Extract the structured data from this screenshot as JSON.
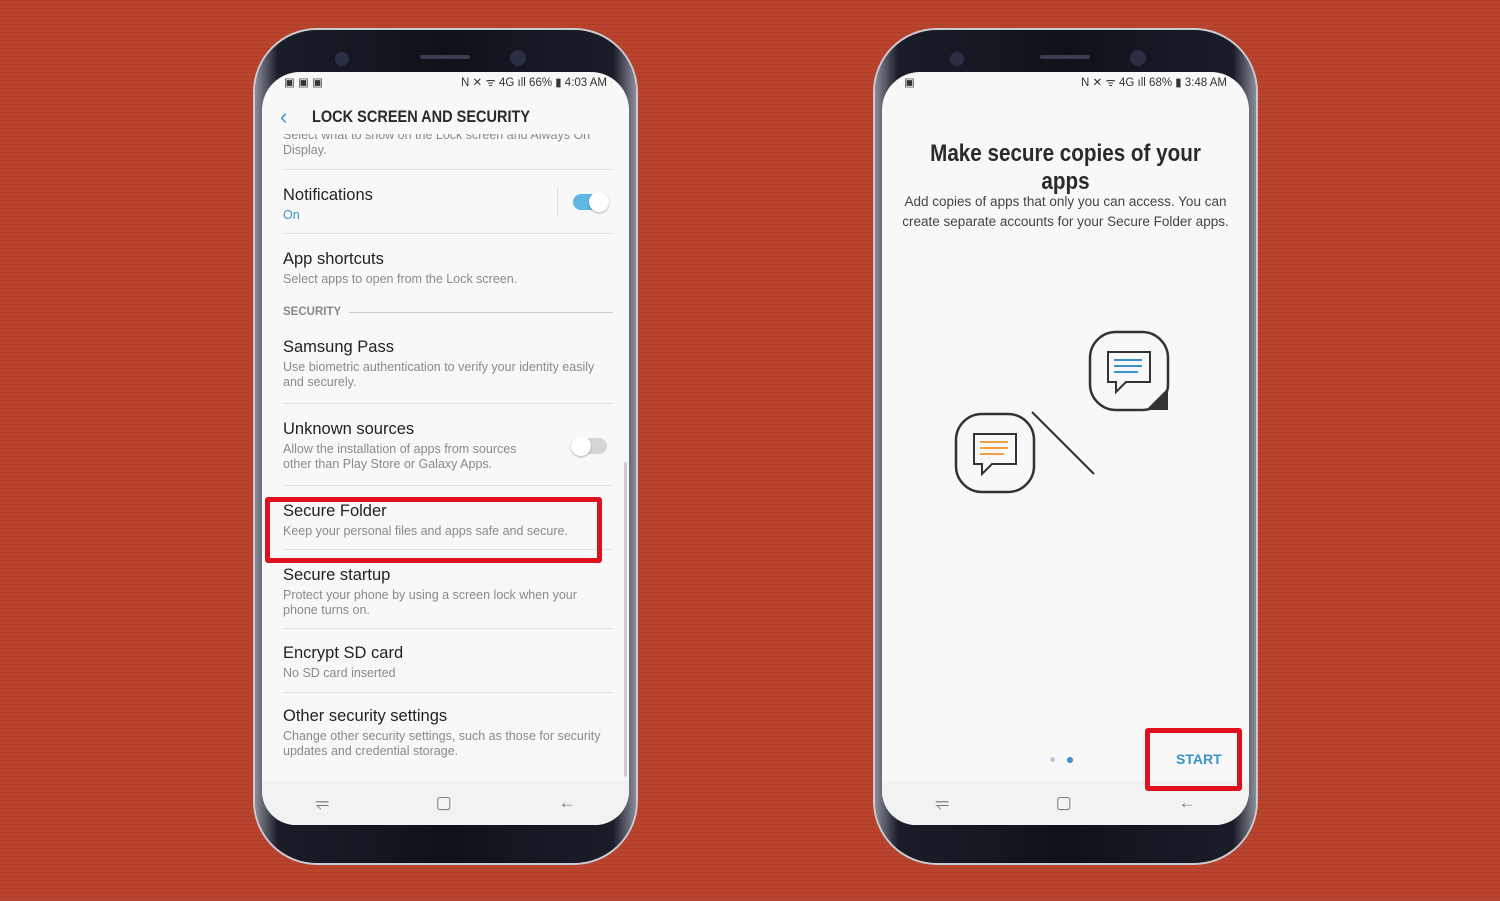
{
  "left_phone": {
    "status": {
      "time": "4:03 AM",
      "battery": "66%"
    },
    "header": {
      "title": "LOCK SCREEN AND SECURITY"
    },
    "partial_item": {
      "subtitle": "Select what to show on the Lock screen and Always On Display."
    },
    "items": [
      {
        "title": "Notifications",
        "subtitle": "On",
        "toggle": true
      },
      {
        "title": "App shortcuts",
        "subtitle": "Select apps to open from the Lock screen."
      }
    ],
    "section": "SECURITY",
    "security_items": [
      {
        "title": "Samsung Pass",
        "subtitle": "Use biometric authentication to verify your identity easily and securely."
      },
      {
        "title": "Unknown sources",
        "subtitle": "Allow the installation of apps from sources other than Play Store or Galaxy Apps.",
        "toggle": false
      },
      {
        "title": "Secure Folder",
        "subtitle": "Keep your personal files and apps safe and secure.",
        "highlighted": true
      },
      {
        "title": "Secure startup",
        "subtitle": "Protect your phone by using a screen lock when your phone turns on."
      },
      {
        "title": "Encrypt SD card",
        "subtitle": "No SD card inserted"
      },
      {
        "title": "Other security settings",
        "subtitle": "Change other security settings, such as those for security updates and credential storage."
      }
    ]
  },
  "right_phone": {
    "status": {
      "time": "3:48 AM",
      "battery": "68%"
    },
    "title": "Make secure copies of your apps",
    "description": "Add copies of apps that only you can access. You can create separate accounts for your Secure Folder apps.",
    "page_indicator": {
      "pages": 2,
      "current": 2
    },
    "start_label": "START"
  },
  "colors": {
    "accent": "#3a94c9",
    "highlight": "#e0101f",
    "background": "#b9432c"
  }
}
